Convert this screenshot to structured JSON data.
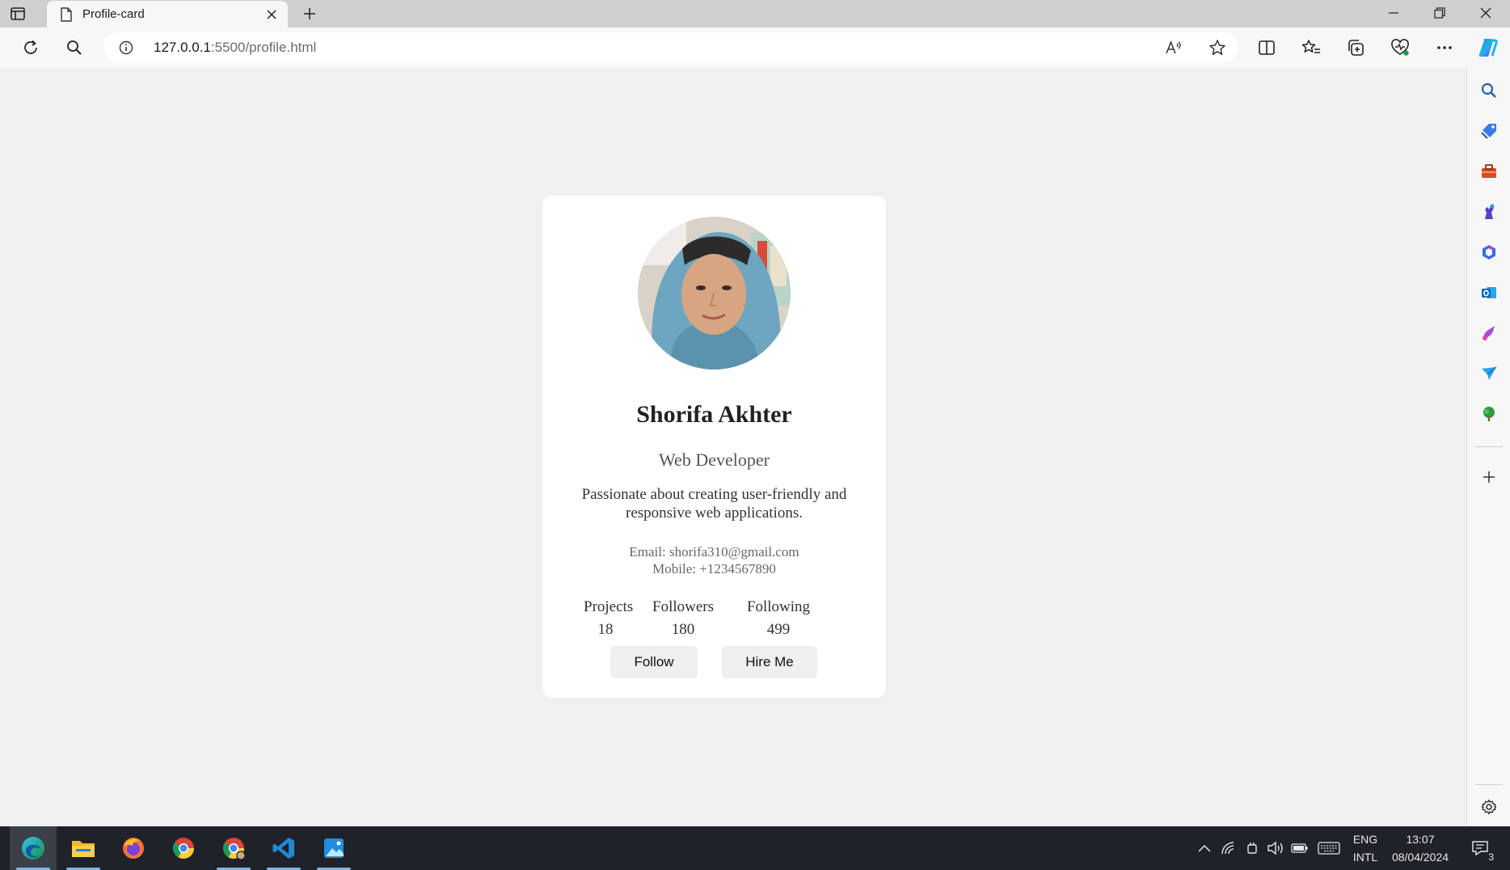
{
  "browser": {
    "tab_title": "Profile-card",
    "url_host": "127.0.0.1",
    "url_rest": ":5500/profile.html"
  },
  "profile": {
    "name": "Shorifa Akhter",
    "role": "Web Developer",
    "bio": "Passionate about creating user-friendly and responsive web applications.",
    "email": "Email: shorifa310@gmail.com",
    "mobile": "Mobile: +1234567890",
    "stats": [
      {
        "label": "Projects",
        "value": "18"
      },
      {
        "label": "Followers",
        "value": "180"
      },
      {
        "label": "Following",
        "value": "499"
      }
    ],
    "buttons": {
      "follow": "Follow",
      "hire": "Hire Me"
    }
  },
  "taskbar": {
    "lang_line1": "ENG",
    "lang_line2": "INTL",
    "time": "13:07",
    "date": "08/04/2024",
    "notification_count": "3"
  }
}
